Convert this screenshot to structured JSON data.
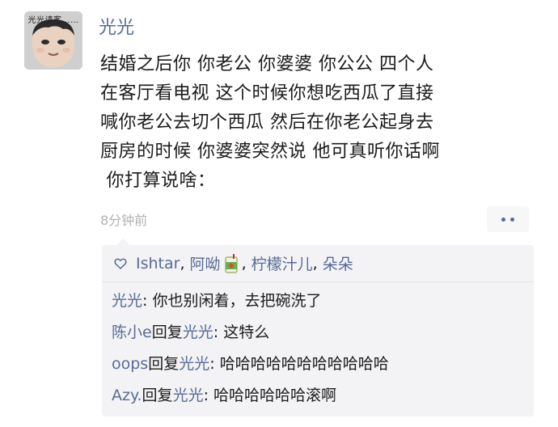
{
  "post": {
    "avatar_caption": "光光请客……",
    "author": "光光",
    "text_lines": [
      "结婚之后你 你老公 你婆婆 你公公 四个人",
      "在客厅看电视 这个时候你想吃西瓜了直接",
      "喊你老公去切个西瓜 然后在你老公起身去",
      "厨房的时候 你婆婆突然说 他可真听你话啊",
      " 你打算说啥："
    ],
    "time": "8分钟前"
  },
  "likes": {
    "names": [
      "Ishtar",
      "阿呦",
      "柠檬汁儿",
      "朵朵"
    ],
    "separator": ", "
  },
  "comments": [
    {
      "name": "光光",
      "reply_word": "",
      "reply_to": "",
      "colon": ": ",
      "text": "你也别闲着，去把碗洗了"
    },
    {
      "name": "陈小e",
      "reply_word": "回复",
      "reply_to": "光光",
      "colon": ": ",
      "text": "这特么"
    },
    {
      "name": "oops",
      "reply_word": "回复",
      "reply_to": "光光",
      "colon": ": ",
      "text": "哈哈哈哈哈哈哈哈哈哈哈"
    },
    {
      "name": "Azy.",
      "reply_word": "回复",
      "reply_to": "光光",
      "colon": ": ",
      "text": "哈哈哈哈哈哈滚啊"
    }
  ],
  "colors": {
    "link": "#576b95",
    "time": "#b2b2b2",
    "comment_bg": "#f3f3f5"
  },
  "icons": {
    "more": "more-dots-icon",
    "like": "heart-outline-icon",
    "juice": "juice-box-emoji-icon"
  }
}
